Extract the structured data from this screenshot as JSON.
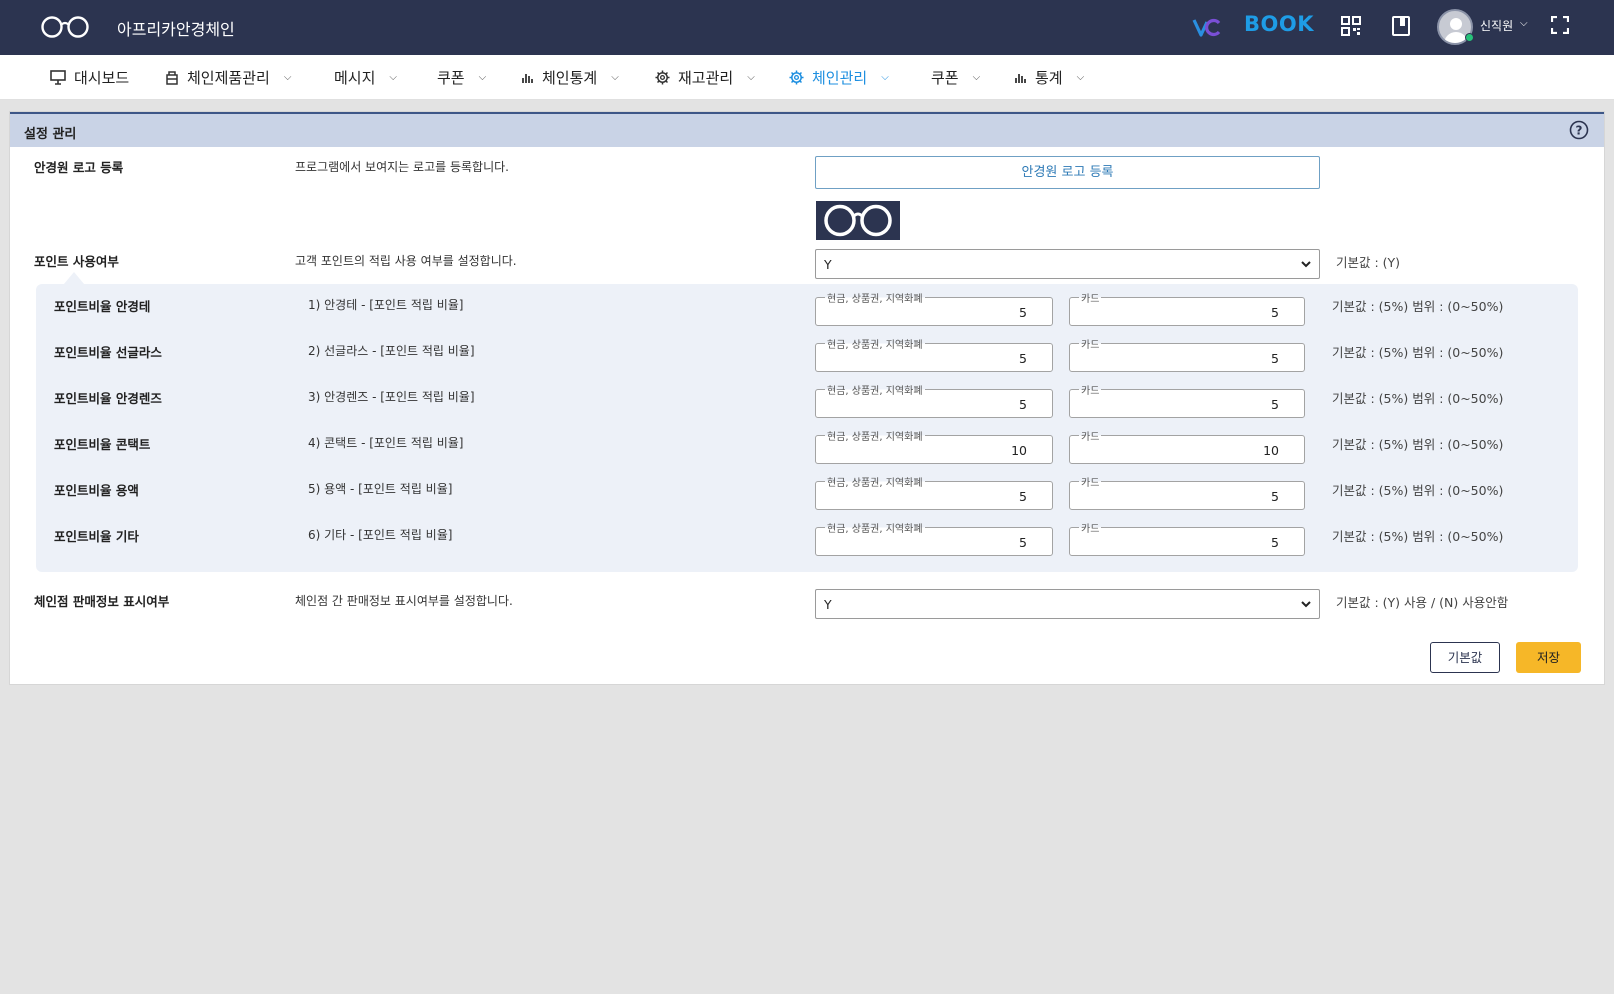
{
  "header": {
    "brand": "아프리카안경체인",
    "book_label": "BOOK",
    "user_name": "신직원",
    "icons": [
      "glasses-logo-icon",
      "vc-logo-icon",
      "qr-code-icon",
      "book-icon",
      "avatar",
      "fullscreen-icon"
    ]
  },
  "nav": [
    {
      "label": "대시보드",
      "icon": "monitor-icon",
      "caret": false
    },
    {
      "label": "체인제품관리",
      "icon": "box-icon",
      "caret": true
    },
    {
      "label": "메시지",
      "icon": "",
      "caret": true
    },
    {
      "label": "쿠폰",
      "icon": "",
      "caret": true
    },
    {
      "label": "체인통계",
      "icon": "bar-chart-icon",
      "caret": true
    },
    {
      "label": "재고관리",
      "icon": "gear-icon",
      "caret": true
    },
    {
      "label": "체인관리",
      "icon": "gear-icon",
      "caret": true,
      "active": true
    },
    {
      "label": "쿠폰",
      "icon": "",
      "caret": true
    },
    {
      "label": "통계",
      "icon": "bar-chart-icon",
      "caret": true
    }
  ],
  "panel": {
    "title": "설정 관리",
    "logo": {
      "label": "안경원 로고 등록",
      "desc": "프로그램에서 보여지는 로고를 등록합니다.",
      "button": "안경원 로고 등록"
    },
    "point_use": {
      "label": "포인트 사용여부",
      "desc": "고객 포인트의 적립 사용 여부를 설정합니다.",
      "value": "Y",
      "note": "기본값 : (Y)"
    },
    "field_labels": {
      "cash": "현금, 상품권, 지역화폐",
      "card": "카드"
    },
    "rates": [
      {
        "label": "포인트비율 안경테",
        "desc": "1) 안경테 - [포인트 적립 비율]",
        "cash": "5",
        "card": "5",
        "note": "기본값 : (5%) 범위 : (0~50%)"
      },
      {
        "label": "포인트비율 선글라스",
        "desc": "2) 선글라스 - [포인트 적립 비율]",
        "cash": "5",
        "card": "5",
        "note": "기본값 : (5%) 범위 : (0~50%)"
      },
      {
        "label": "포인트비율 안경렌즈",
        "desc": "3) 안경렌즈 - [포인트 적립 비율]",
        "cash": "5",
        "card": "5",
        "note": "기본값 : (5%) 범위 : (0~50%)"
      },
      {
        "label": "포인트비율 콘택트",
        "desc": "4) 콘택트 - [포인트 적립 비율]",
        "cash": "10",
        "card": "10",
        "note": "기본값 : (5%) 범위 : (0~50%)"
      },
      {
        "label": "포인트비율 용액",
        "desc": "5) 용액 - [포인트 적립 비율]",
        "cash": "5",
        "card": "5",
        "note": "기본값 : (5%) 범위 : (0~50%)"
      },
      {
        "label": "포인트비율 기타",
        "desc": "6) 기타 - [포인트 적립 비율]",
        "cash": "5",
        "card": "5",
        "note": "기본값 : (5%) 범위 : (0~50%)"
      }
    ],
    "sales_info": {
      "label": "체인점 판매정보 표시여부",
      "desc": "체인점 간 판매정보 표시여부를 설정합니다.",
      "value": "Y",
      "note": "기본값 : (Y) 사용 / (N) 사용안함"
    },
    "buttons": {
      "default": "기본값",
      "save": "저장"
    }
  },
  "colors": {
    "topbar": "#2c3450",
    "accent": "#1e8fe0",
    "save": "#f6b728",
    "panel_header": "#c9d3e6"
  }
}
